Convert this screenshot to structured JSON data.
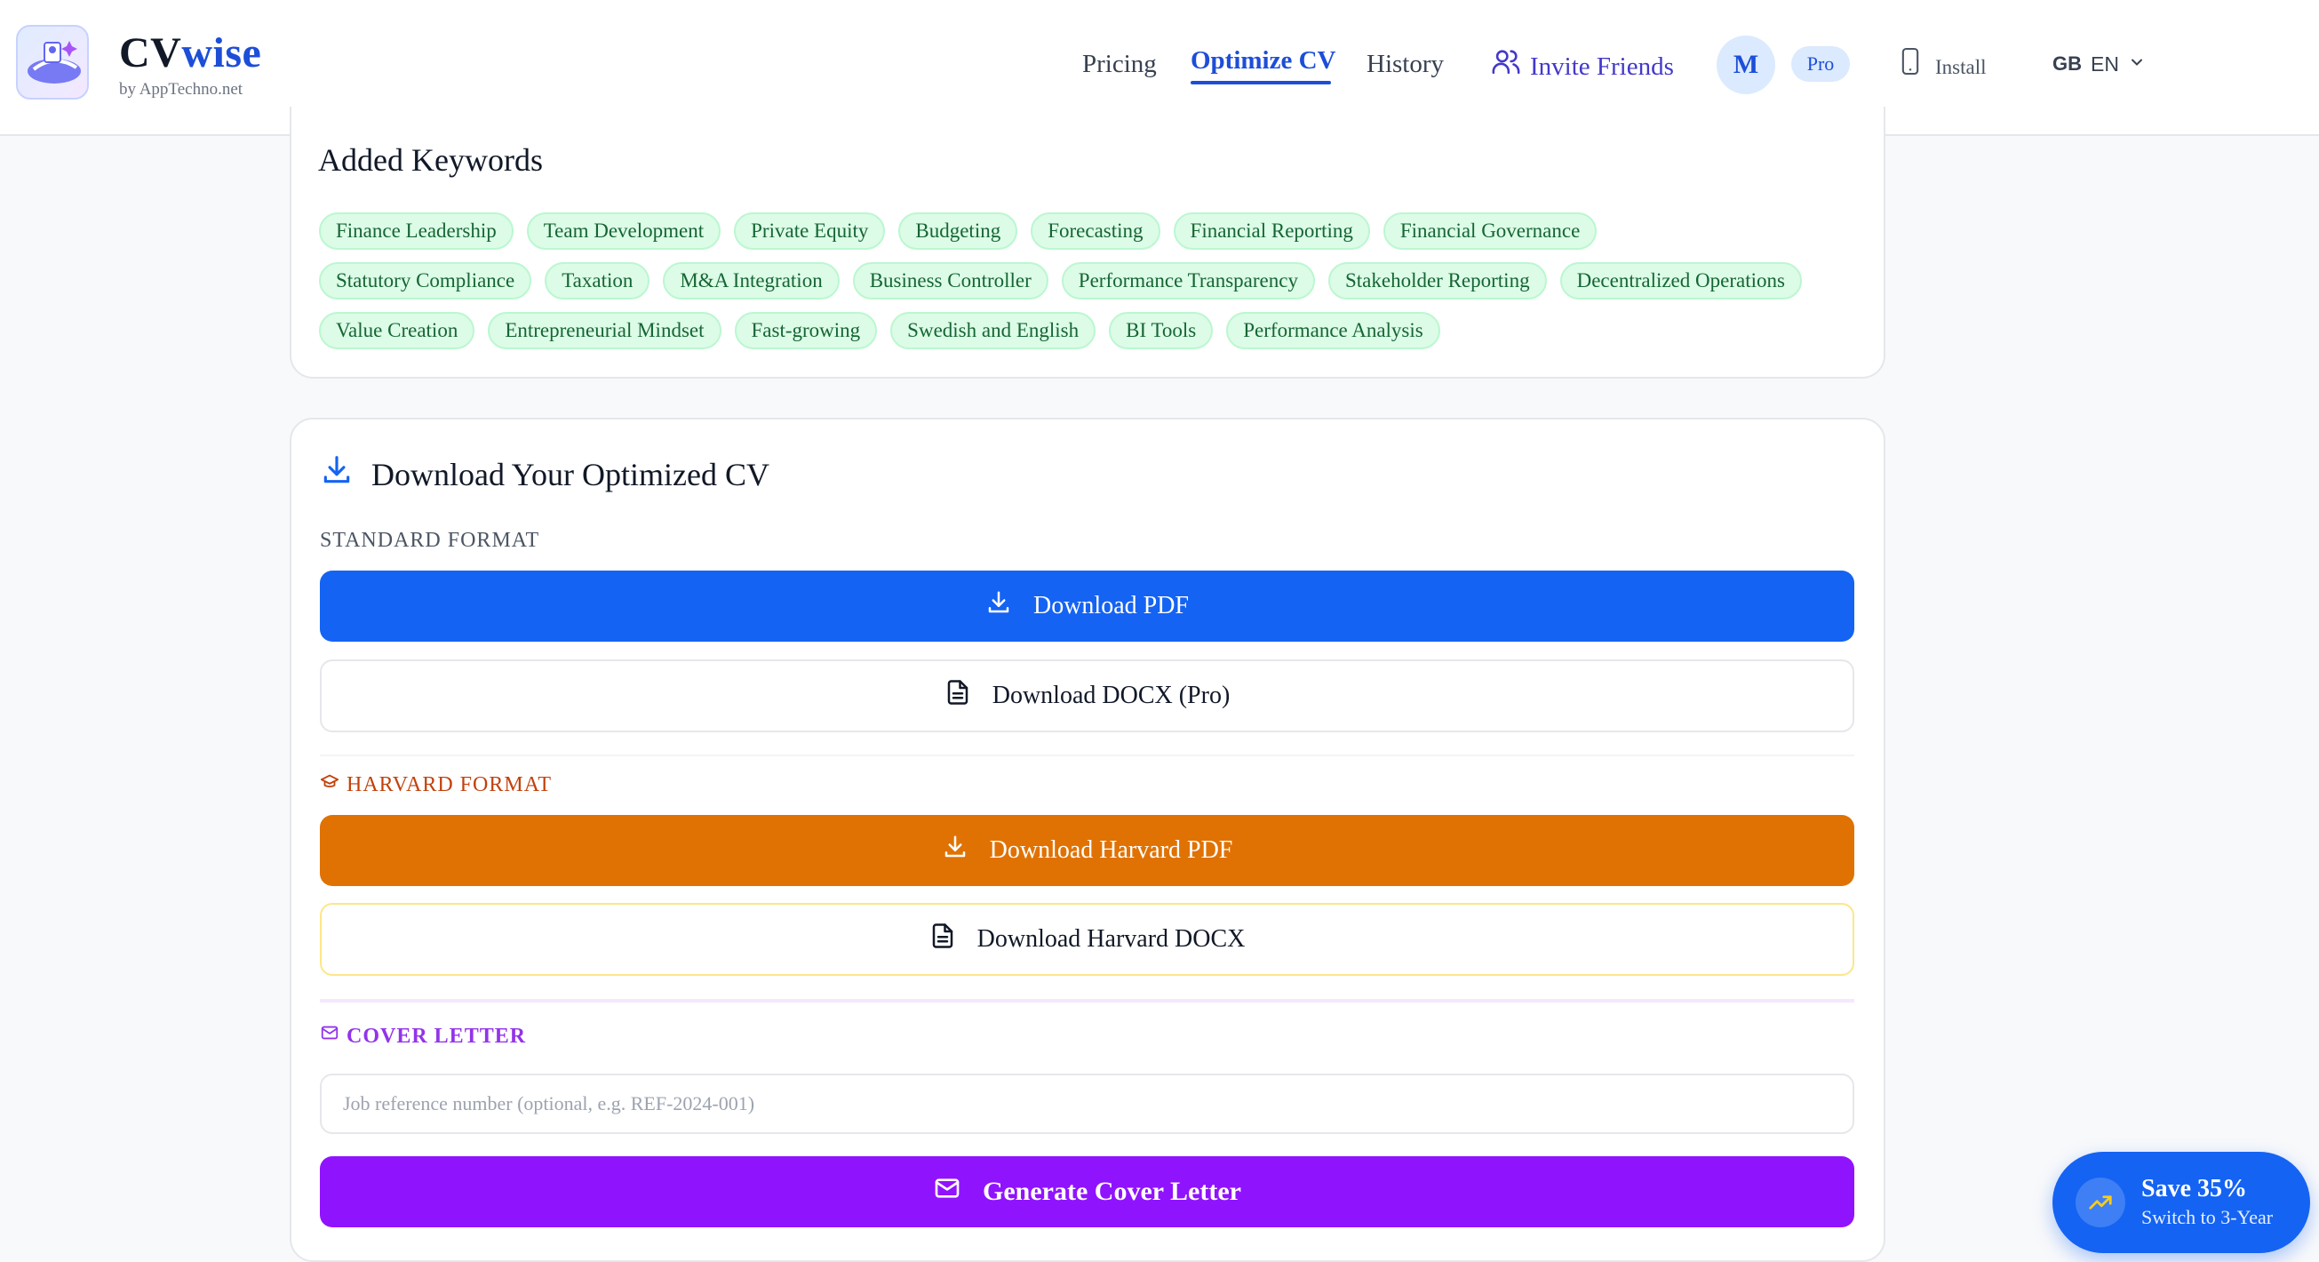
{
  "brand": {
    "name_part1": "CV",
    "name_part2": "wise",
    "byline": "by AppTechno.net"
  },
  "nav": {
    "pricing": "Pricing",
    "optimize": "Optimize CV",
    "history": "History",
    "invite": "Invite Friends",
    "avatar_initial": "M",
    "plan_badge": "Pro",
    "install": "Install",
    "region": "GB",
    "language": "EN"
  },
  "keywords": {
    "title": "Added Keywords",
    "rows": [
      [
        "Finance Leadership",
        "Team Development",
        "Private Equity",
        "Budgeting",
        "Forecasting",
        "Financial Reporting",
        "Financial Governance"
      ],
      [
        "Statutory Compliance",
        "Taxation",
        "M&A Integration",
        "Business Controller",
        "Performance Transparency",
        "Stakeholder Reporting",
        "Decentralized Operations"
      ],
      [
        "Value Creation",
        "Entrepreneurial Mindset",
        "Fast-growing",
        "Swedish and English",
        "BI Tools",
        "Performance Analysis"
      ]
    ]
  },
  "download": {
    "title": "Download Your Optimized CV",
    "standard_label": "STANDARD FORMAT",
    "pdf_label": "Download PDF",
    "docx_label": "Download DOCX (Pro)",
    "harvard_label": "HARVARD FORMAT",
    "harvard_pdf_label": "Download Harvard PDF",
    "harvard_docx_label": "Download Harvard DOCX",
    "cover_label": "COVER LETTER",
    "reference_placeholder": "Job reference number (optional, e.g. REF-2024-001)",
    "reference_value": "",
    "cover_button_label": "Generate Cover Letter"
  },
  "promo": {
    "title": "Save 35%",
    "subtitle": "Switch to 3-Year"
  },
  "colors": {
    "accent_blue": "#1463f3",
    "harvard_orange": "#e07203",
    "cover_purple": "#9013fe",
    "keyword_green": "#dcfce7"
  }
}
